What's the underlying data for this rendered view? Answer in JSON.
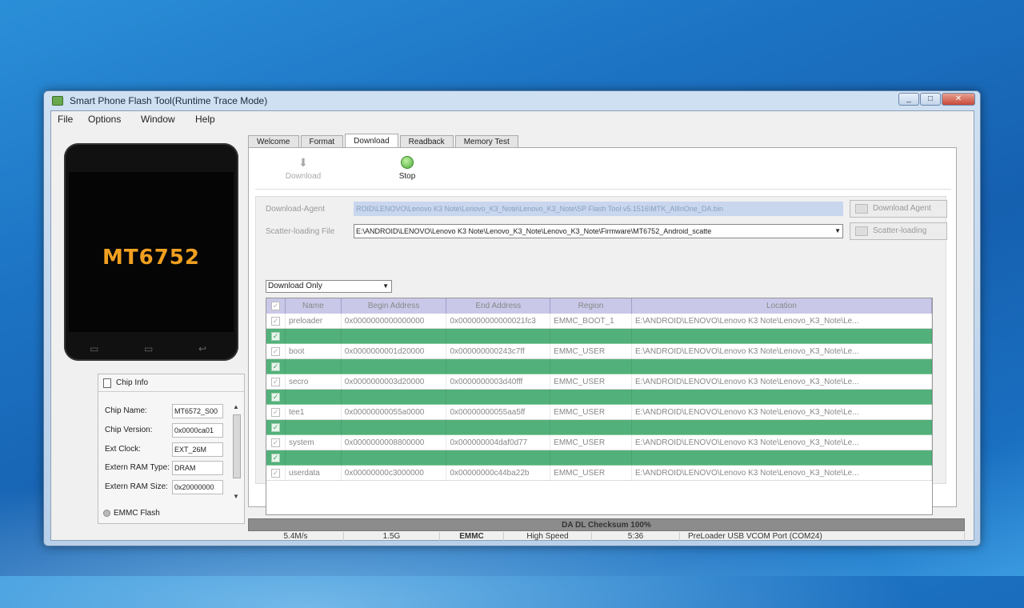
{
  "window": {
    "title": "Smart Phone Flash Tool(Runtime Trace Mode)"
  },
  "menu": [
    "File",
    "Options",
    "Window",
    "Help"
  ],
  "phone": {
    "chip": "MT6752"
  },
  "chip_info": {
    "header": "Chip Info",
    "rows": [
      {
        "label": "Chip Name:",
        "value": "MT6572_S00"
      },
      {
        "label": "Chip Version:",
        "value": "0x0000ca01"
      },
      {
        "label": "Ext Clock:",
        "value": "EXT_26M"
      },
      {
        "label": "Extern RAM Type:",
        "value": "DRAM"
      },
      {
        "label": "Extern RAM Size:",
        "value": "0x20000000"
      }
    ],
    "emmc_flash": "EMMC Flash"
  },
  "tabs": [
    "Welcome",
    "Format",
    "Download",
    "Readback",
    "Memory Test"
  ],
  "active_tab": "Download",
  "toolbar": {
    "download": "Download",
    "stop": "Stop"
  },
  "download_agent": {
    "label": "Download-Agent",
    "value": "ROID\\LENOVO\\Lenovo K3 Note\\Lenovo_K3_Note\\Lenovo_K3_Note\\SP Flash Tool v5.1516\\MTK_AllInOne_DA.bin",
    "button": "Download Agent"
  },
  "scatter": {
    "label": "Scatter-loading File",
    "value": "E:\\ANDROID\\LENOVO\\Lenovo K3 Note\\Lenovo_K3_Note\\Lenovo_K3_Note\\Firmware\\MT6752_Android_scatte",
    "button": "Scatter-loading"
  },
  "mode": "Download Only",
  "table": {
    "headers": [
      "",
      "Name",
      "Begin Address",
      "End Address",
      "Region",
      "Location"
    ],
    "rows": [
      {
        "name": "preloader",
        "begin": "0x0000000000000000",
        "end": "0x000000000000021fc3",
        "region": "EMMC_BOOT_1",
        "location": "E:\\ANDROID\\LENOVO\\Lenovo K3 Note\\Lenovo_K3_Note\\Le..."
      },
      {
        "name": "",
        "begin": "",
        "end": "",
        "region": "",
        "location": ""
      },
      {
        "name": "boot",
        "begin": "0x0000000001d20000",
        "end": "0x000000000243c7ff",
        "region": "EMMC_USER",
        "location": "E:\\ANDROID\\LENOVO\\Lenovo K3 Note\\Lenovo_K3_Note\\Le..."
      },
      {
        "name": "",
        "begin": "",
        "end": "",
        "region": "",
        "location": ""
      },
      {
        "name": "secro",
        "begin": "0x0000000003d20000",
        "end": "0x0000000003d40fff",
        "region": "EMMC_USER",
        "location": "E:\\ANDROID\\LENOVO\\Lenovo K3 Note\\Lenovo_K3_Note\\Le..."
      },
      {
        "name": "",
        "begin": "",
        "end": "",
        "region": "",
        "location": ""
      },
      {
        "name": "tee1",
        "begin": "0x00000000055a0000",
        "end": "0x00000000055aa5ff",
        "region": "EMMC_USER",
        "location": "E:\\ANDROID\\LENOVO\\Lenovo K3 Note\\Lenovo_K3_Note\\Le..."
      },
      {
        "name": "",
        "begin": "",
        "end": "",
        "region": "",
        "location": ""
      },
      {
        "name": "system",
        "begin": "0x0000000008800000",
        "end": "0x000000004daf0d77",
        "region": "EMMC_USER",
        "location": "E:\\ANDROID\\LENOVO\\Lenovo K3 Note\\Lenovo_K3_Note\\Le..."
      },
      {
        "name": "",
        "begin": "",
        "end": "",
        "region": "",
        "location": ""
      },
      {
        "name": "userdata",
        "begin": "0x00000000c3000000",
        "end": "0x00000000c44ba22b",
        "region": "EMMC_USER",
        "location": "E:\\ANDROID\\LENOVO\\Lenovo K3 Note\\Lenovo_K3_Note\\Le..."
      }
    ]
  },
  "progress": {
    "text": "DA DL Checksum 100%",
    "percent": 100
  },
  "status": [
    "5.4M/s",
    "1.5G",
    "EMMC",
    "High Speed",
    "5:36",
    "PreLoader USB VCOM Port (COM24)"
  ],
  "colors": {
    "row_green": "#52b07a",
    "header_purple": "#c9c8e8",
    "chip_orange": "#f0a020"
  }
}
